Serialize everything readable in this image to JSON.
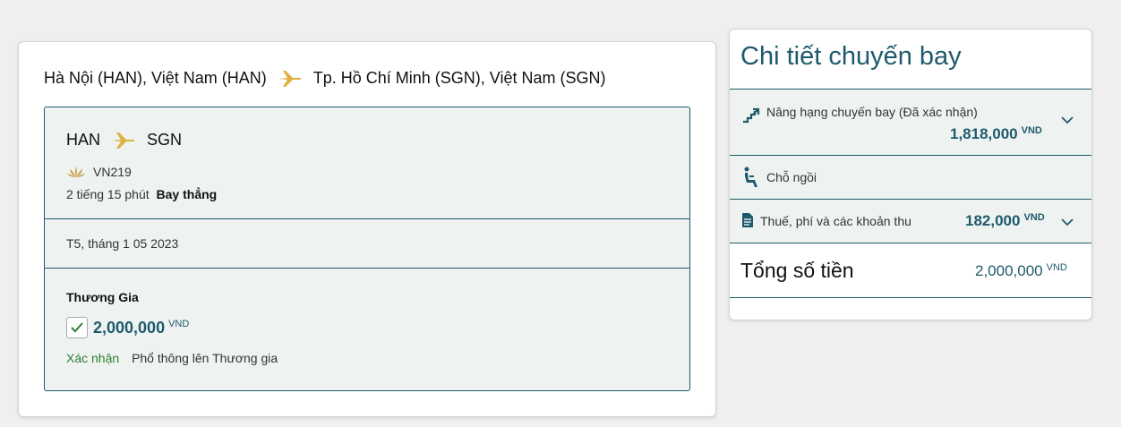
{
  "itinerary": {
    "origin": "Hà Nội (HAN), Việt Nam (HAN)",
    "destination": "Tp. Hồ Chí Minh (SGN), Việt Nam (SGN)"
  },
  "flight": {
    "from_code": "HAN",
    "to_code": "SGN",
    "flight_number": "VN219",
    "duration": "2 tiếng 15 phút",
    "stops": "Bay thẳng",
    "date": "T5, tháng 1 05 2023",
    "cabin": "Thương Gia",
    "price": "2,000,000",
    "currency": "VND",
    "status": "Xác nhận",
    "upgrade_note": "Phổ thông lên Thương gia"
  },
  "details": {
    "title": "Chi tiết chuyến bay",
    "upgrade_label": "Nâng hạng chuyến bay (Đã xác nhận)",
    "upgrade_amount": "1,818,000",
    "seat_label": "Chỗ ngồi",
    "tax_label": "Thuế, phí và các khoản thu",
    "tax_amount": "182,000",
    "total_label": "Tổng số tiền",
    "total_amount": "2,000,000",
    "currency": "VND"
  },
  "colors": {
    "accent": "#1e5a6b",
    "plane": "#e0b040",
    "confirm": "#2e7d32",
    "background": "#efefef",
    "panel_tint": "#eef3f1"
  },
  "icons": {
    "plane": "airplane-icon",
    "lotus": "lotus-logo-icon",
    "check": "checkmark-icon",
    "upgrade": "upgrade-stairs-icon",
    "seat": "seat-icon",
    "document": "document-icon",
    "chevron": "chevron-down-icon"
  }
}
